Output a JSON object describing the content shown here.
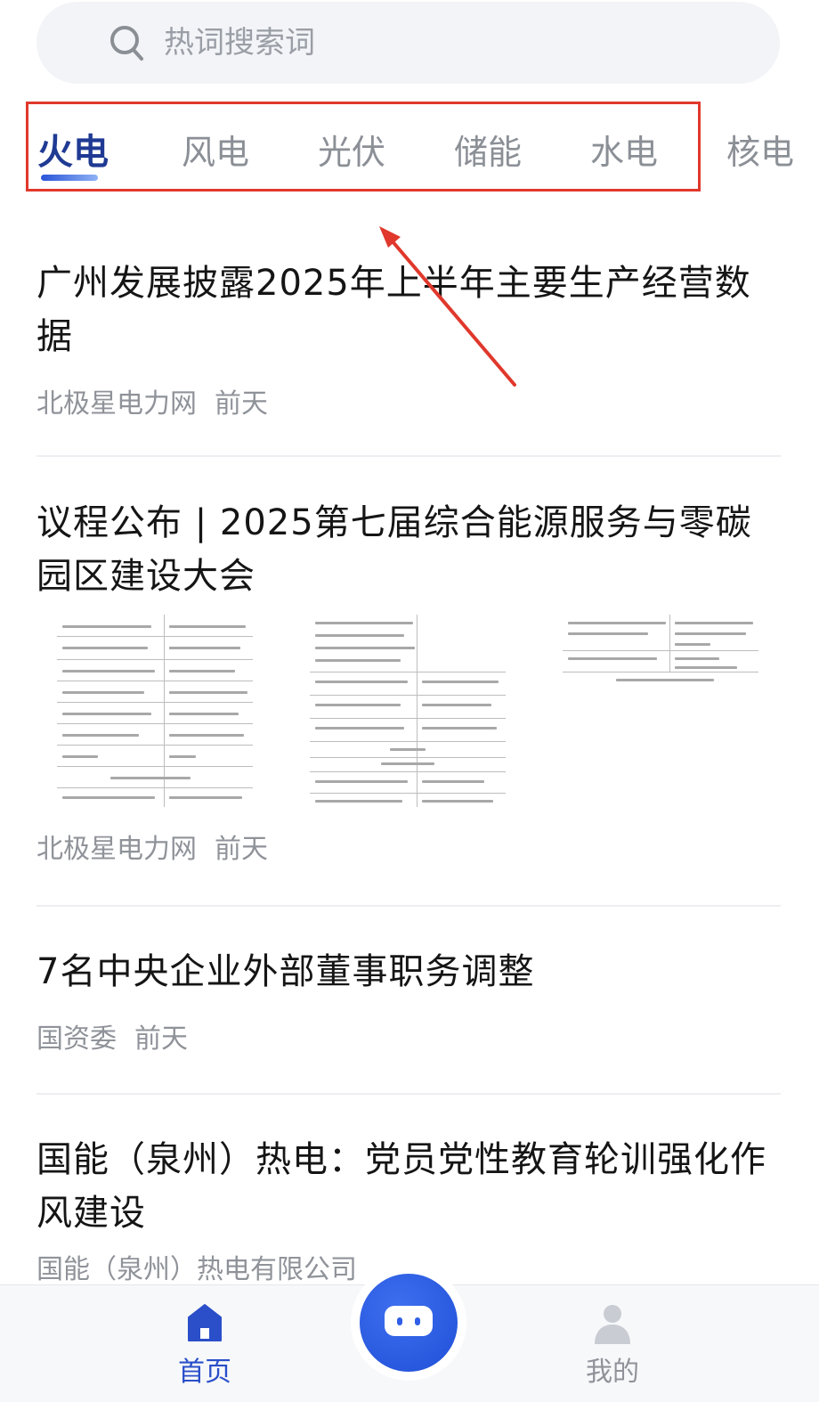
{
  "search": {
    "placeholder": "热词搜索词"
  },
  "tabs": [
    {
      "label": "火电",
      "active": true
    },
    {
      "label": "风电",
      "active": false
    },
    {
      "label": "光伏",
      "active": false
    },
    {
      "label": "储能",
      "active": false
    },
    {
      "label": "水电",
      "active": false
    },
    {
      "label": "核电",
      "active": false
    }
  ],
  "articles": [
    {
      "title": "广州发展披露2025年上半年主要生产经营数据",
      "source": "北极星电力网",
      "time": "前天"
    },
    {
      "title": "议程公布 | 2025第七届综合能源服务与零碳园区建设大会",
      "source": "北极星电力网",
      "time": "前天"
    },
    {
      "title": "7名中央企业外部董事职务调整",
      "source": "国资委",
      "time": "前天"
    },
    {
      "title": "国能（泉州）热电：党员党性教育轮训强化作风建设",
      "source": "国能（泉州）热电有限公司",
      "time": ""
    }
  ],
  "nav": {
    "home": "首页",
    "me": "我的"
  },
  "colors": {
    "accent": "#1f3a93",
    "highlight_box": "#e0382c",
    "center_button": "#2f5ee8"
  },
  "icons": [
    "search-icon",
    "home-icon",
    "chat-bot-icon",
    "user-icon"
  ]
}
